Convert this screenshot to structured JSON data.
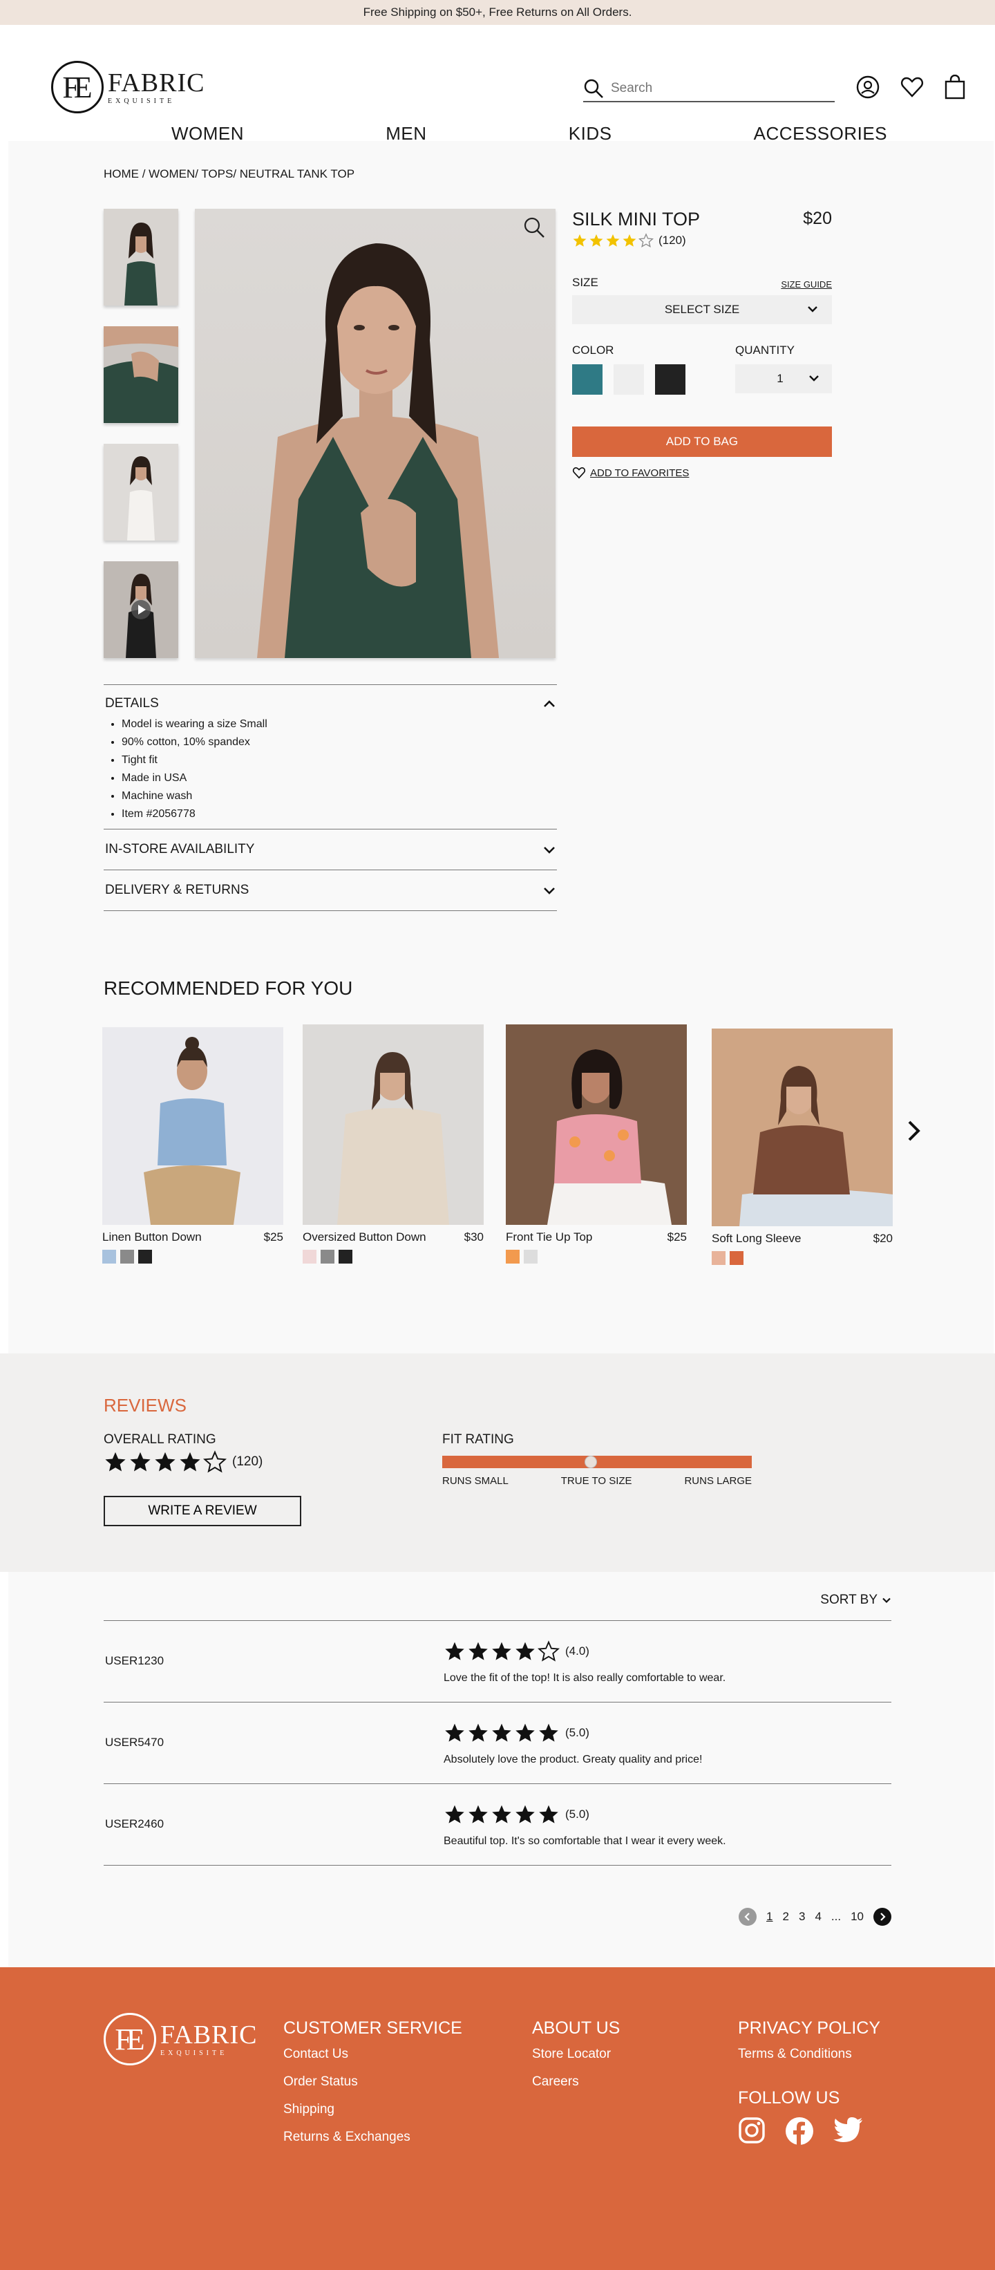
{
  "promo": {
    "text": "Free Shipping on $50+, Free Returns on All Orders."
  },
  "header": {
    "logo": {
      "monogram": "FE",
      "name": "FABRIC",
      "sub": "EXQUISITE"
    },
    "search_placeholder": "Search",
    "nav": [
      "WOMEN",
      "MEN",
      "KIDS",
      "ACCESSORIES"
    ]
  },
  "breadcrumb": "HOME / WOMEN/ TOPS/ NEUTRAL TANK TOP",
  "product": {
    "title": "SILK MINI TOP",
    "price": "$20",
    "rating": 4,
    "rating_count": "(120)",
    "size_label": "SIZE",
    "size_guide": "SIZE GUIDE",
    "size_select": "SELECT SIZE",
    "color_label": "COLOR",
    "colors": [
      "#2f7a85",
      "#eeeeee",
      "#222222"
    ],
    "quantity_label": "QUANTITY",
    "quantity": "1",
    "add_to_bag": "ADD TO BAG",
    "add_to_favorites": "ADD TO FAVORITES"
  },
  "details": {
    "title": "DETAILS",
    "items": [
      "Model is wearing a size Small",
      "90% cotton, 10% spandex",
      "Tight fit",
      "Made in USA",
      "Machine wash",
      "Item #2056778"
    ],
    "in_store": "IN-STORE AVAILABILITY",
    "delivery": "DELIVERY & RETURNS"
  },
  "recommended": {
    "title": "RECOMMENDED FOR YOU",
    "items": [
      {
        "name": "Linen Button Down",
        "price": "$25",
        "swatches": [
          "#a8c2de",
          "#8a8a8a",
          "#222222"
        ]
      },
      {
        "name": "Oversized Button Down",
        "price": "$30",
        "swatches": [
          "#f0d8d8",
          "#8a8a8a",
          "#222222"
        ]
      },
      {
        "name": "Front Tie Up Top",
        "price": "$25",
        "swatches": [
          "#f29a4e",
          "#dddddd"
        ]
      },
      {
        "name": "Soft Long Sleeve",
        "price": "$20",
        "swatches": [
          "#e8b39a",
          "#d9673d"
        ]
      }
    ]
  },
  "reviews": {
    "title": "REVIEWS",
    "overall_label": "OVERALL RATING",
    "overall_rating": 4,
    "overall_count": "(120)",
    "write_review": "WRITE A REVIEW",
    "fit_label": "FIT RATING",
    "fit_value": 0.48,
    "fit_ticks": [
      "RUNS SMALL",
      "TRUE TO SIZE",
      "RUNS LARGE"
    ],
    "sort_by": "SORT BY",
    "list": [
      {
        "user": "USER1230",
        "rating": 4,
        "score": "(4.0)",
        "text": "Love the fit of the top! It is also really comfortable to wear."
      },
      {
        "user": "USER5470",
        "rating": 5,
        "score": "(5.0)",
        "text": "Absolutely love the product. Greaty quality and price!"
      },
      {
        "user": "USER2460",
        "rating": 5,
        "score": "(5.0)",
        "text": "Beautiful top. It's so comfortable that I wear it every week."
      }
    ],
    "pages": [
      "1",
      "2",
      "3",
      "4",
      "...",
      "10"
    ]
  },
  "footer": {
    "logo": {
      "monogram": "FE",
      "name": "FABRIC",
      "sub": "EXQUISITE"
    },
    "customer_service": {
      "title": "CUSTOMER SERVICE",
      "links": [
        "Contact Us",
        "Order Status",
        "Shipping",
        "Returns & Exchanges"
      ]
    },
    "about": {
      "title": "ABOUT US",
      "links": [
        "Store Locator",
        "Careers"
      ]
    },
    "privacy": {
      "title": "PRIVACY POLICY",
      "links": [
        "Terms & Conditions"
      ]
    },
    "follow": {
      "title": "FOLLOW US",
      "icons": [
        "instagram-icon",
        "facebook-icon",
        "twitter-icon"
      ]
    }
  },
  "colors": {
    "accent": "#d9673d",
    "star": "#f2c200"
  }
}
